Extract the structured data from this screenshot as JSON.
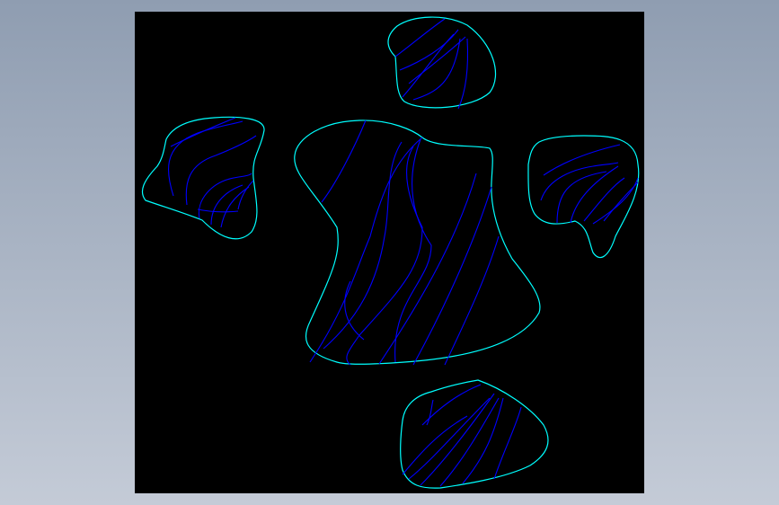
{
  "window": {
    "background_top": "#8f9db1",
    "background_bottom": "#c4cbd7"
  },
  "viewport": {
    "background": "#000000",
    "outline_color": "#00ffff",
    "hatch_color": "#0000ff"
  },
  "drawing": {
    "shapes": [
      "center-blob",
      "top-blob",
      "left-blob",
      "right-blob",
      "bottom-blob"
    ]
  }
}
